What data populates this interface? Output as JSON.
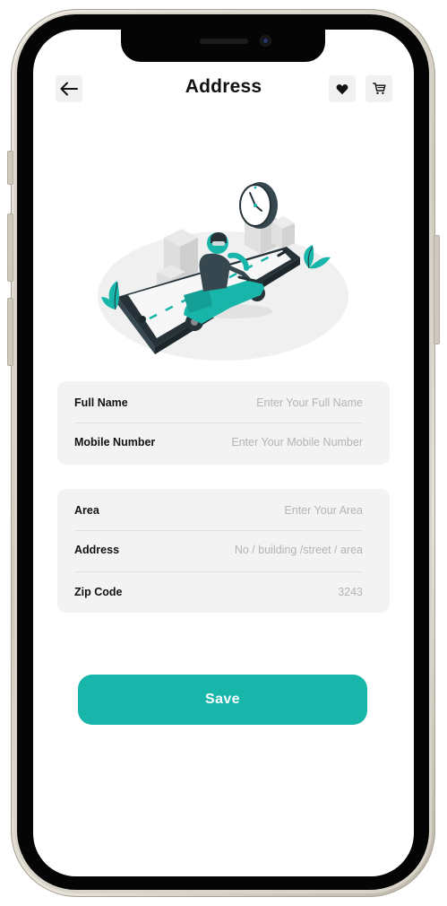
{
  "header": {
    "title": "Address",
    "back_icon": "arrow-left-icon",
    "favorite_icon": "heart-icon",
    "cart_icon": "cart-icon"
  },
  "illustration": {
    "subject": "delivery scooter on phone"
  },
  "contact_form": {
    "fields": [
      {
        "label": "Full Name",
        "placeholder": "Enter Your Full Name"
      },
      {
        "label": "Mobile Number",
        "placeholder": "Enter Your Mobile Number"
      }
    ]
  },
  "address_form": {
    "fields": [
      {
        "label": "Area",
        "placeholder": "Enter Your Area"
      },
      {
        "label": "Address",
        "placeholder": "No / building /street / area"
      },
      {
        "label": "Zip Code",
        "placeholder": "3243"
      }
    ]
  },
  "actions": {
    "save_label": "Save"
  },
  "colors": {
    "accent": "#18b5aa",
    "field_background": "#f3f3f3",
    "placeholder_text": "#b4b4b4"
  }
}
